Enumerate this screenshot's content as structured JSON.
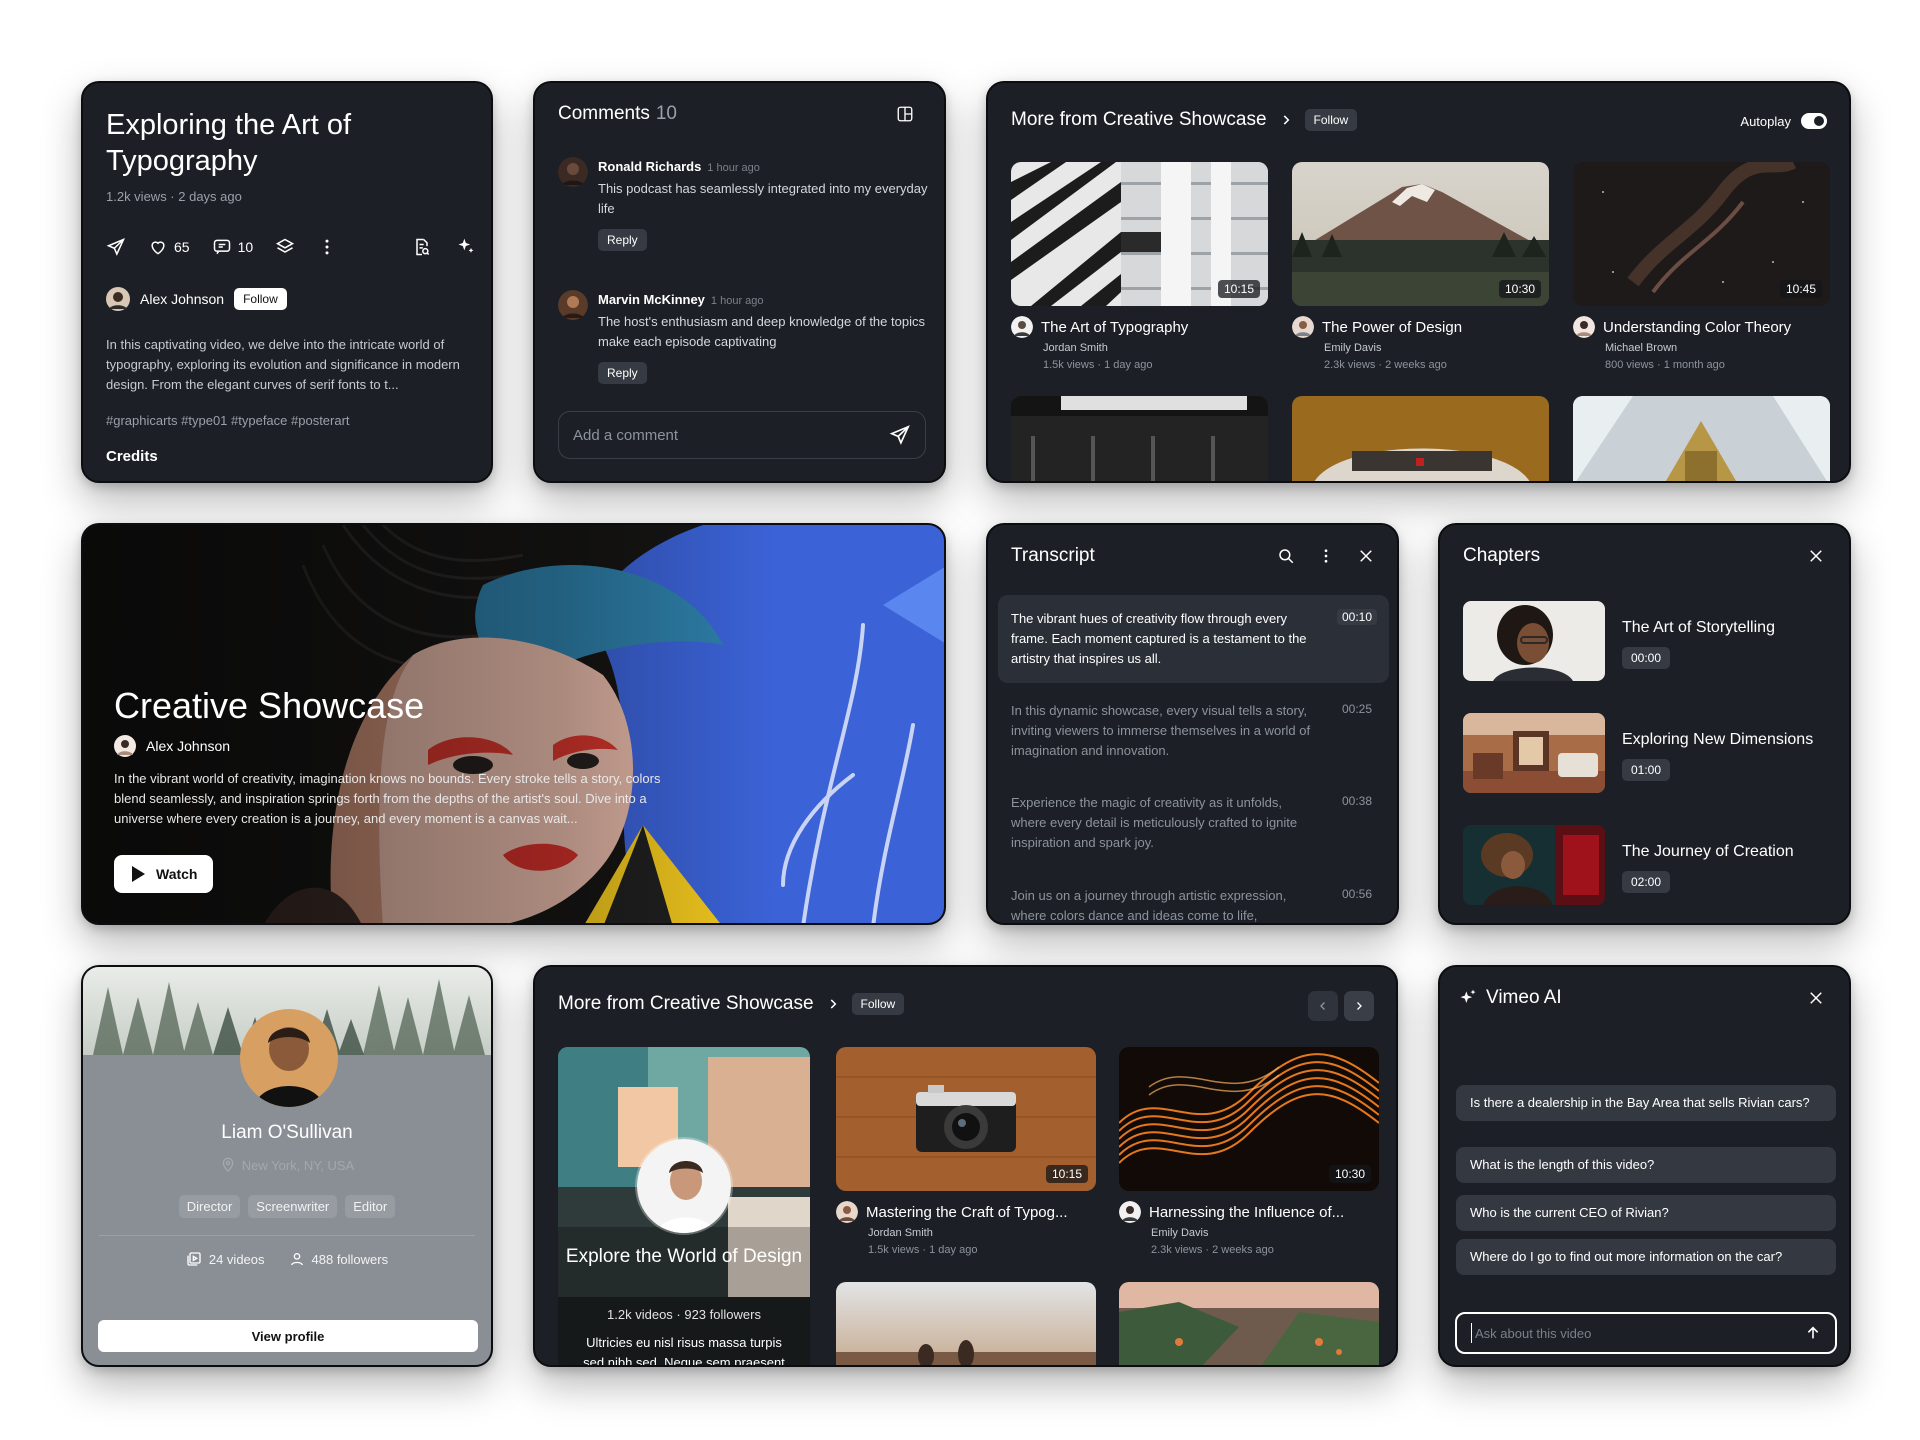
{
  "video_card": {
    "title": "Exploring the Art of Typography",
    "meta": "1.2k views · 2 days ago",
    "likes": "65",
    "comments": "10",
    "author": "Alex Johnson",
    "follow": "Follow",
    "description": "In this captivating video, we delve into the intricate world of typography, exploring its evolution and significance in modern design. From the elegant curves of serif fonts to t...",
    "tags": "#graphicarts #type01 #typeface #posterart",
    "credits": "Credits"
  },
  "comments_card": {
    "title": "Comments",
    "count": "10",
    "items": [
      {
        "name": "Ronald Richards",
        "time": "1 hour ago",
        "text": "This podcast has seamlessly integrated into my everyday life",
        "reply": "Reply"
      },
      {
        "name": "Marvin McKinney",
        "time": "1 hour ago",
        "text": "The host's enthusiasm and deep knowledge of the topics make each episode captivating",
        "reply": "Reply"
      }
    ],
    "input_placeholder": "Add a comment"
  },
  "more_top": {
    "title": "More from Creative Showcase",
    "follow": "Follow",
    "autoplay_label": "Autoplay",
    "autoplay_on": true,
    "videos": [
      {
        "title": "The Art of Typography",
        "channel": "Jordan Smith",
        "stats": "1.5k views · 1 day ago",
        "duration": "10:15"
      },
      {
        "title": "The Power of Design",
        "channel": "Emily Davis",
        "stats": "2.3k views · 2 weeks ago",
        "duration": "10:30"
      },
      {
        "title": "Understanding Color Theory",
        "channel": "Michael Brown",
        "stats": "800 views · 1 month ago",
        "duration": "10:45"
      }
    ]
  },
  "hero": {
    "title": "Creative Showcase",
    "author": "Alex Johnson",
    "description": "In the vibrant world of creativity, imagination knows no bounds. Every stroke tells a story, colors blend seamlessly, and inspiration springs forth from the depths of the artist's soul. Dive into a universe where every creation is a journey, and every moment is a canvas wait...",
    "watch": "Watch"
  },
  "transcript": {
    "title": "Transcript",
    "items": [
      {
        "text": "The vibrant hues of creativity flow through every frame. Each moment captured is a testament to the artistry that inspires us all.",
        "time": "00:10",
        "active": true
      },
      {
        "text": "In this dynamic showcase, every visual tells a story, inviting viewers to immerse themselves in a world of imagination and innovation.",
        "time": "00:25",
        "active": false
      },
      {
        "text": "Experience the magic of creativity as it unfolds, where every detail is meticulously crafted to ignite inspiration and spark joy.",
        "time": "00:38",
        "active": false
      },
      {
        "text": "Join us on a journey through artistic expression, where colors dance and ideas come to life,",
        "time": "00:56",
        "active": false
      }
    ]
  },
  "chapters": {
    "title": "Chapters",
    "items": [
      {
        "title": "The Art of Storytelling",
        "time": "00:00"
      },
      {
        "title": "Exploring New Dimensions",
        "time": "01:00"
      },
      {
        "title": "The Journey of Creation",
        "time": "02:00"
      }
    ]
  },
  "profile": {
    "name": "Liam O'Sullivan",
    "location": "New York, NY, USA",
    "roles": [
      "Director",
      "Screenwriter",
      "Editor"
    ],
    "videos": "24 videos",
    "followers": "488 followers",
    "view_profile": "View profile"
  },
  "more_bottom": {
    "title": "More from Creative Showcase",
    "follow": "Follow",
    "feature": {
      "title": "Explore the World of Design",
      "stats": "1.2k videos · 923 followers",
      "description": "Ultricies eu nisl risus massa turpis sed nibh sed. Neque sem praesent"
    },
    "videos": [
      {
        "title": "Mastering the Craft of Typog...",
        "channel": "Jordan Smith",
        "stats": "1.5k views · 1 day ago",
        "duration": "10:15"
      },
      {
        "title": "Harnessing the Influence of...",
        "channel": "Emily Davis",
        "stats": "2.3k views · 2 weeks ago",
        "duration": "10:30"
      }
    ]
  },
  "vimeo_ai": {
    "title": "Vimeo AI",
    "suggestions": [
      "Is there a dealership in the Bay Area that sells Rivian cars?",
      "What is the length of this video?",
      "Who is the current CEO of Rivian?",
      "Where do I go to find out more information on the car?"
    ],
    "input_placeholder": "Ask about this video"
  }
}
